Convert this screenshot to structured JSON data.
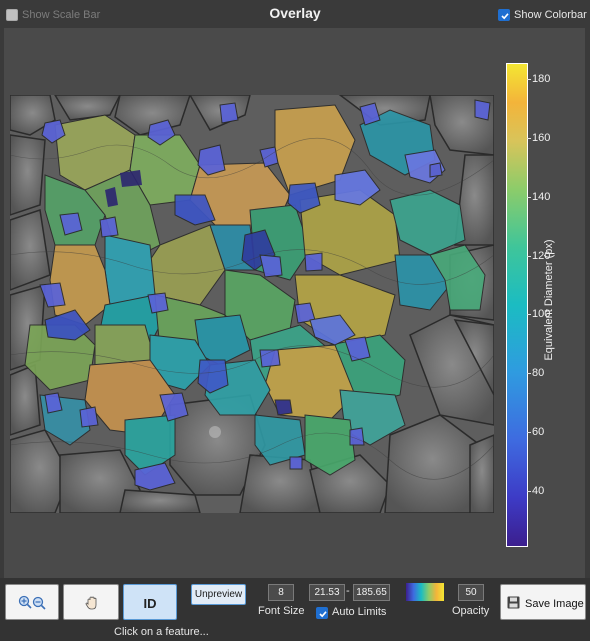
{
  "header": {
    "title": "Overlay",
    "show_scale_bar": {
      "label": "Show Scale Bar",
      "checked": false
    },
    "show_colorbar": {
      "label": "Show Colorbar",
      "checked": true
    }
  },
  "colorbar": {
    "label": "Equivalent Diameter (px)",
    "ticks": [
      "180",
      "160",
      "140",
      "120",
      "100",
      "80",
      "60",
      "40"
    ],
    "colors": {
      "low": "#3c1f8e",
      "mid": "#1bbcc2",
      "high": "#f3e633"
    }
  },
  "toolbar": {
    "zoom_icon": "zoom-in-out-icon",
    "pan_icon": "hand-icon",
    "id_label": "ID",
    "unpreview_label": "Unpreview",
    "font_size_value": "8",
    "font_size_label": "Font Size",
    "limit_min": "21.53",
    "limit_sep": "-",
    "limit_max": "185.65",
    "auto_limits_label": "Auto Limits",
    "auto_limits_checked": true,
    "opacity_value": "50",
    "opacity_label": "Opacity",
    "save_label": "Save Image",
    "status_text": "Click on a feature..."
  }
}
